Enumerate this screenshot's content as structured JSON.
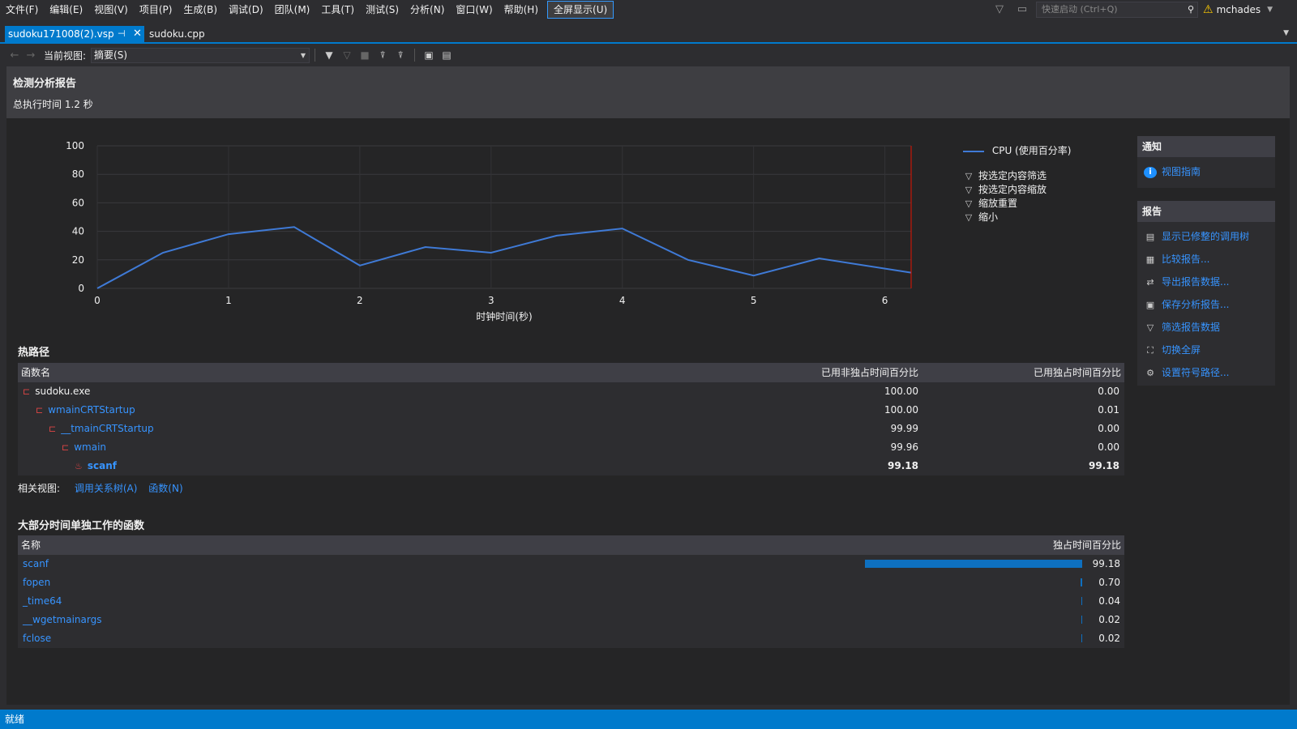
{
  "menu": {
    "items": [
      "文件(F)",
      "编辑(E)",
      "视图(V)",
      "项目(P)",
      "生成(B)",
      "调试(D)",
      "团队(M)",
      "工具(T)",
      "测试(S)",
      "分析(N)",
      "窗口(W)",
      "帮助(H)"
    ],
    "fullscreen": "全屏显示(U)",
    "quick_launch_placeholder": "快速启动 (Ctrl+Q)",
    "user": "mchades"
  },
  "tabs": {
    "active": "sudoku171008(2).vsp",
    "pin": "⊣",
    "close": "✕",
    "second": "sudoku.cpp"
  },
  "toolbar": {
    "view_label": "当前视图:",
    "view_value": "摘要(S)"
  },
  "report": {
    "title": "检测分析报告",
    "total_time": "总执行时间 1.2 秒"
  },
  "chart_data": {
    "type": "line",
    "series": [
      {
        "name": "CPU (使用百分率)",
        "color": "#3f7ad6",
        "x": [
          0,
          0.5,
          1,
          1.5,
          2,
          2.5,
          3,
          3.5,
          4,
          4.5,
          5,
          5.5,
          6.2
        ],
        "y": [
          0,
          25,
          38,
          43,
          16,
          29,
          25,
          37,
          42,
          20,
          9,
          21,
          11
        ]
      }
    ],
    "xlabel": "时钟时间(秒)",
    "ylabel": "",
    "xlim": [
      0,
      6.2
    ],
    "ylim": [
      0,
      100
    ],
    "xticks": [
      0,
      1,
      2,
      3,
      4,
      5,
      6
    ],
    "yticks": [
      0,
      20,
      40,
      60,
      80,
      100
    ],
    "marker_x": 6.2,
    "marker_color": "#e51400",
    "grid": true,
    "legend_placement": "right"
  },
  "chart_actions": [
    "按选定内容筛选",
    "按选定内容缩放",
    "缩放重置",
    "缩小"
  ],
  "hot_path": {
    "title": "热路径",
    "columns": [
      "函数名",
      "已用非独占时间百分比",
      "已用独占时间百分比"
    ],
    "rows": [
      {
        "name": "sudoku.exe",
        "inclusive": "100.00",
        "exclusive": "0.00",
        "level": 0,
        "link": false,
        "bold": false
      },
      {
        "name": "wmainCRTStartup",
        "inclusive": "100.00",
        "exclusive": "0.01",
        "level": 1,
        "link": true,
        "bold": false
      },
      {
        "name": "__tmainCRTStartup",
        "inclusive": "99.99",
        "exclusive": "0.00",
        "level": 2,
        "link": true,
        "bold": false
      },
      {
        "name": "wmain",
        "inclusive": "99.96",
        "exclusive": "0.00",
        "level": 3,
        "link": true,
        "bold": false
      },
      {
        "name": "scanf",
        "inclusive": "99.18",
        "exclusive": "99.18",
        "level": 4,
        "link": true,
        "bold": true
      }
    ]
  },
  "related": {
    "label": "相关视图:",
    "call_tree": "调用关系树(A)",
    "functions": "函数(N)"
  },
  "solo_functions": {
    "title": "大部分时间单独工作的函数",
    "columns": [
      "名称",
      "独占时间百分比"
    ],
    "rows": [
      {
        "name": "scanf",
        "value": "99.18",
        "percent": 99.18
      },
      {
        "name": "fopen",
        "value": "0.70",
        "percent": 0.7
      },
      {
        "name": "_time64",
        "value": "0.04",
        "percent": 0.04
      },
      {
        "name": "__wgetmainargs",
        "value": "0.02",
        "percent": 0.02
      },
      {
        "name": "fclose",
        "value": "0.02",
        "percent": 0.02
      }
    ]
  },
  "side_panel": {
    "notify_title": "通知",
    "notify_link": "视图指南",
    "report_title": "报告",
    "report_links": [
      "显示已修整的调用树",
      "比较报告...",
      "导出报告数据...",
      "保存分析报告...",
      "筛选报告数据",
      "切换全屏",
      "设置符号路径..."
    ]
  },
  "status": {
    "text": "就绪"
  }
}
